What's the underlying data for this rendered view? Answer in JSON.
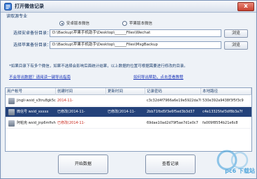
{
  "window": {
    "title": "打开微信记录",
    "close_label": "x"
  },
  "source_group": {
    "label": "读取源专业",
    "options": [
      {
        "label": "安卓版本微信",
        "checked": true
      },
      {
        "label": "苹果版本微信",
        "checked": false
      }
    ]
  },
  "fields": [
    {
      "label": "选择安卓备份目录：",
      "value": "D:\\Backup\\苹果手机助手\\Desktop\\______Files\\Wechat",
      "button": "浏览"
    },
    {
      "label": "选择苹果备份目录：",
      "value": "D:\\Backup\\苹果手机助手\\Desktop\\______Files\\MsgBackup",
      "button": "浏览"
    }
  ],
  "note": "*如果目录下有多个微信，如果不选择会影响后面统计结果，以上数据的位置可根据需要进行修改的目录。",
  "links": {
    "left": "不会导出数据？请阅读一键导出指南",
    "right": "如何导出帮助，点击查看教程"
  },
  "table": {
    "headers": [
      "用户帐号",
      "创建时间",
      "更新时间",
      "记录密码",
      "本地路径"
    ],
    "rows": [
      {
        "account": "jingli·wxid_s3tru8gk5c22",
        "created": "2014-11-",
        "updated": "",
        "password": "c3c32d4f7966a6e19e5922da70",
        "path": "530e392a9438f3f5f3c9",
        "selected": false
      },
      {
        "account": "微信号 wxid_xxxxx",
        "created": "已修改(2014-11-",
        "updated": "已修改(2014-11-",
        "password": "2bb71fbd5f3e6f5ed3b3d37",
        "path": "c4e13325faf3df8b3a7f",
        "selected": true
      },
      {
        "account": "阿帕克·wxid_jnp6mfivh2e1z3",
        "created": "已修改(2014-11-",
        "updated": "",
        "password": "69dae10ad2d79f5ae7d1e0c7",
        "path": "fa009f8554b21e6c8",
        "selected": false
      }
    ]
  },
  "buttons": {
    "open": "开始数据",
    "view": "查看记录"
  },
  "watermark": {
    "text": "pc6 下载站"
  },
  "colors": {
    "accent": "#24427a",
    "link": "#1a35b8",
    "label": "#1d3f6e",
    "red": "#c8281c"
  }
}
